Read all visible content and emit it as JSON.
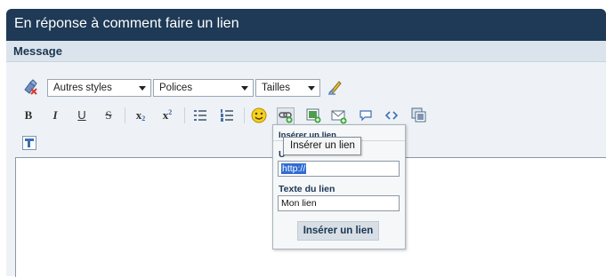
{
  "window": {
    "title": "En réponse à comment faire un lien"
  },
  "section": {
    "title": "Message"
  },
  "toolbar": {
    "styles_select": "Autres styles",
    "fonts_select": "Polices",
    "sizes_select": "Tailles",
    "format_buttons": {
      "bold": "B",
      "italic": "I",
      "underline": "U",
      "strike": "S",
      "subscript": "x",
      "subscript_mark": "2",
      "superscript": "x",
      "superscript_mark": "2"
    }
  },
  "tooltip": {
    "text": "Insérer un lien"
  },
  "link_popup": {
    "title": "Insérer un lien",
    "url_label": "U",
    "url_value": "http://",
    "text_label": "Texte du lien",
    "text_value": "Mon lien",
    "submit_label": "Insérer un lien"
  },
  "icons": [
    "remove-format-icon",
    "pen-icon",
    "bullet-list-icon",
    "numbered-list-icon",
    "smiley-icon",
    "insert-link-icon",
    "insert-image-icon",
    "insert-email-icon",
    "quote-icon",
    "code-icon",
    "media-icon",
    "toggle-source-icon"
  ]
}
